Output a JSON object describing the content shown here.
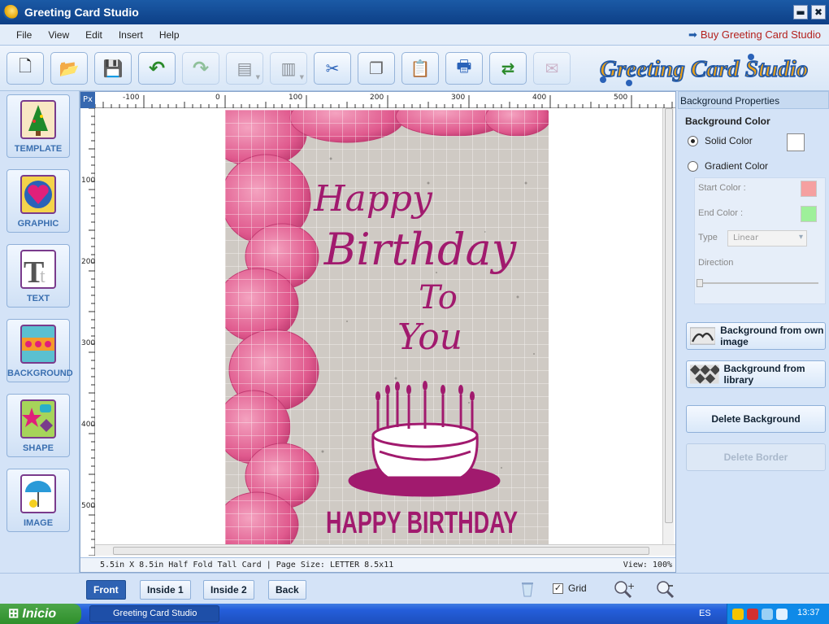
{
  "window": {
    "title": "Greeting Card Studio",
    "min": "▬",
    "close": "✖"
  },
  "menu": {
    "items": [
      "File",
      "View",
      "Edit",
      "Insert",
      "Help"
    ],
    "buy_link": "Buy Greeting Card Studio"
  },
  "toolbar": {
    "buttons": [
      {
        "name": "new-icon",
        "glyph": "🗋"
      },
      {
        "name": "open-folder-icon",
        "glyph": "📂"
      },
      {
        "name": "save-icon",
        "glyph": "💾"
      },
      {
        "name": "undo-icon",
        "glyph": "↶"
      },
      {
        "name": "redo-icon",
        "glyph": "↷"
      },
      {
        "name": "layer-forward-icon",
        "glyph": "▤"
      },
      {
        "name": "layer-back-icon",
        "glyph": "▥"
      },
      {
        "name": "cut-icon",
        "glyph": "✂"
      },
      {
        "name": "copy-icon",
        "glyph": "❐"
      },
      {
        "name": "paste-icon",
        "glyph": "📋"
      },
      {
        "name": "print-icon",
        "glyph": "🖶"
      },
      {
        "name": "share-icon",
        "glyph": "⇄"
      },
      {
        "name": "email-icon",
        "glyph": "✉"
      }
    ],
    "brand": "Greeting Card Studio"
  },
  "left_tools": [
    "TEMPLATE",
    "GRAPHIC",
    "TEXT",
    "BACKGROUND",
    "SHAPE",
    "IMAGE"
  ],
  "ruler": {
    "corner": "Px",
    "h_labels": [
      "-100",
      "0",
      "100",
      "200",
      "300",
      "400",
      "500"
    ],
    "v_labels": [
      "100",
      "200",
      "300",
      "400",
      "500"
    ]
  },
  "card": {
    "line1": "Happy",
    "line2": "Birthday",
    "line3": "To",
    "line4": "You",
    "bottom": "HAPPY BIRTHDAY",
    "accent": "#a11a6e",
    "petal": "#e05a8e"
  },
  "status": {
    "left": "5.5in X 8.5in Half Fold Tall Card | Page Size: LETTER 8.5x11",
    "right": "View: 100%"
  },
  "properties": {
    "header": "Background Properties",
    "section": "Background Color",
    "solid": "Solid Color",
    "gradient": "Gradient Color",
    "start_color": "Start Color :",
    "end_color": "End Color :",
    "type": "Type",
    "type_value": "Linear",
    "direction": "Direction",
    "start_swatch": "#f5a0a0",
    "end_swatch": "#9ef09a",
    "bg_own": "Background from own image",
    "bg_library": "Background from library",
    "delete_bg": "Delete Background",
    "delete_border": "Delete Border"
  },
  "pages": {
    "tabs": [
      "Front",
      "Inside 1",
      "Inside 2",
      "Back"
    ],
    "active": 0,
    "grid": "Grid"
  },
  "taskbar": {
    "start": "Inicio",
    "task": "Greeting Card Studio",
    "lang": "ES",
    "clock": "13:37"
  }
}
